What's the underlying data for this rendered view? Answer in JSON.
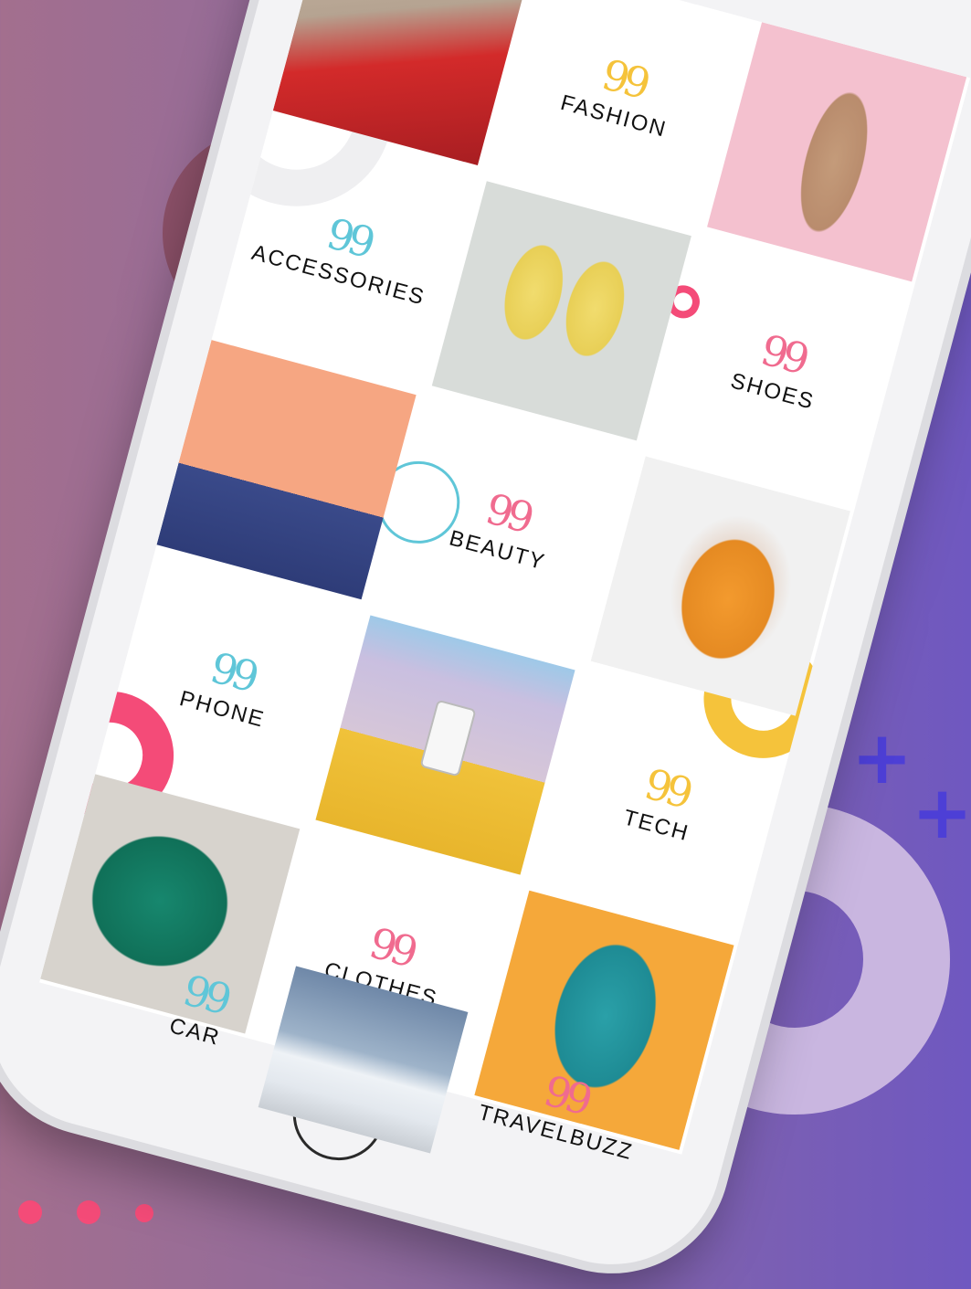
{
  "categories": [
    {
      "label": "FASHION",
      "quote_color": "#f5c33b"
    },
    {
      "label": "ACCESSORIES",
      "quote_color": "#5fc6d8"
    },
    {
      "label": "SHOES",
      "quote_color": "#f06b8f"
    },
    {
      "label": "BEAUTY",
      "quote_color": "#f06b8f"
    },
    {
      "label": "PHONE",
      "quote_color": "#5fc6d8"
    },
    {
      "label": "TECH",
      "quote_color": "#f5c33b"
    },
    {
      "label": "CLOTHES",
      "quote_color": "#f06b8f"
    },
    {
      "label": "CAR",
      "quote_color": "#5fc6d8"
    },
    {
      "label": "TRAVELBUZZ",
      "quote_color": "#f06b8f"
    }
  ],
  "quote_glyph": "99",
  "photos": [
    {
      "name": "red-pants-heels-photo",
      "colors": [
        "#c9b8a6",
        "#d32a2a"
      ]
    },
    {
      "name": "pink-dress-walking-photo",
      "colors": [
        "#f4c1cf",
        "#c49b7a"
      ]
    },
    {
      "name": "yellow-flats-photo",
      "colors": [
        "#d8dcd9",
        "#f1dc6e"
      ]
    },
    {
      "name": "makeup-bag-photo",
      "colors": [
        "#f6a682",
        "#3a4a8a"
      ]
    },
    {
      "name": "face-mask-woman-photo",
      "colors": [
        "#f1f1f1",
        "#f39a2e"
      ]
    },
    {
      "name": "hand-holding-phone-photo",
      "colors": [
        "#c9bfe0",
        "#f0c23a"
      ]
    },
    {
      "name": "green-dress-photo",
      "colors": [
        "#d7d3cd",
        "#17876e"
      ]
    },
    {
      "name": "checkered-dress-photo",
      "colors": [
        "#f5a83a",
        "#2aa0a8"
      ]
    },
    {
      "name": "white-sports-car-photo",
      "colors": [
        "#9eb3c9",
        "#eef2f6"
      ]
    }
  ],
  "accent_colors": {
    "pink": "#f44b78",
    "yellow": "#f5c33b",
    "blue": "#5fc6d8",
    "purple": "#4d3fd6"
  }
}
